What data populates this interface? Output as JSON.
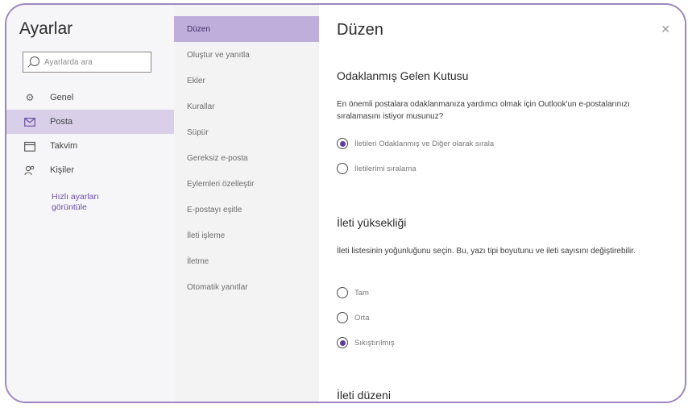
{
  "settings": {
    "title": "Ayarlar",
    "search_placeholder": "Ayarlarda ara",
    "nav": [
      {
        "label": "Genel",
        "icon": "gear-icon"
      },
      {
        "label": "Posta",
        "icon": "mail-icon"
      },
      {
        "label": "Takvim",
        "icon": "calendar-icon"
      },
      {
        "label": "Kişiler",
        "icon": "people-icon"
      }
    ],
    "quick_link": "Hızlı ayarları görüntüle"
  },
  "mail_menu": [
    "Düzen",
    "Oluştur ve yanıtla",
    "Ekler",
    "Kurallar",
    "Süpür",
    "Gereksiz e-posta",
    "Eylemleri özelleştir",
    "E-postayı eşitle",
    "İleti işleme",
    "İletme",
    "Otomatik yanıtlar"
  ],
  "pane": {
    "title": "Düzen",
    "focused_inbox": {
      "heading": "Odaklanmış Gelen Kutusu",
      "description": "En önemli postalara odaklanmanıza yardımcı olmak için Outlook'un e-postalarınızı sıralamasını istiyor musunuz?",
      "options": [
        "İletileri Odaklanmış ve Diğer olarak sırala",
        "İletilerimi sıralama"
      ],
      "selected": 0
    },
    "message_height": {
      "heading": "İleti yüksekliği",
      "description": "İleti listesinin yoğunluğunu seçin. Bu, yazı tipi boyutunu ve ileti sayısını değiştirebilir.",
      "options": [
        "Tam",
        "Orta",
        "Sıkıştırılmış"
      ],
      "selected": 2
    },
    "message_layout": {
      "heading": "İleti düzeni"
    }
  },
  "colors": {
    "accent": "#5b3fa0",
    "active_left": "#d9cfe9",
    "active_mid": "#bfaedb",
    "frame_border": "#9b86c2"
  }
}
